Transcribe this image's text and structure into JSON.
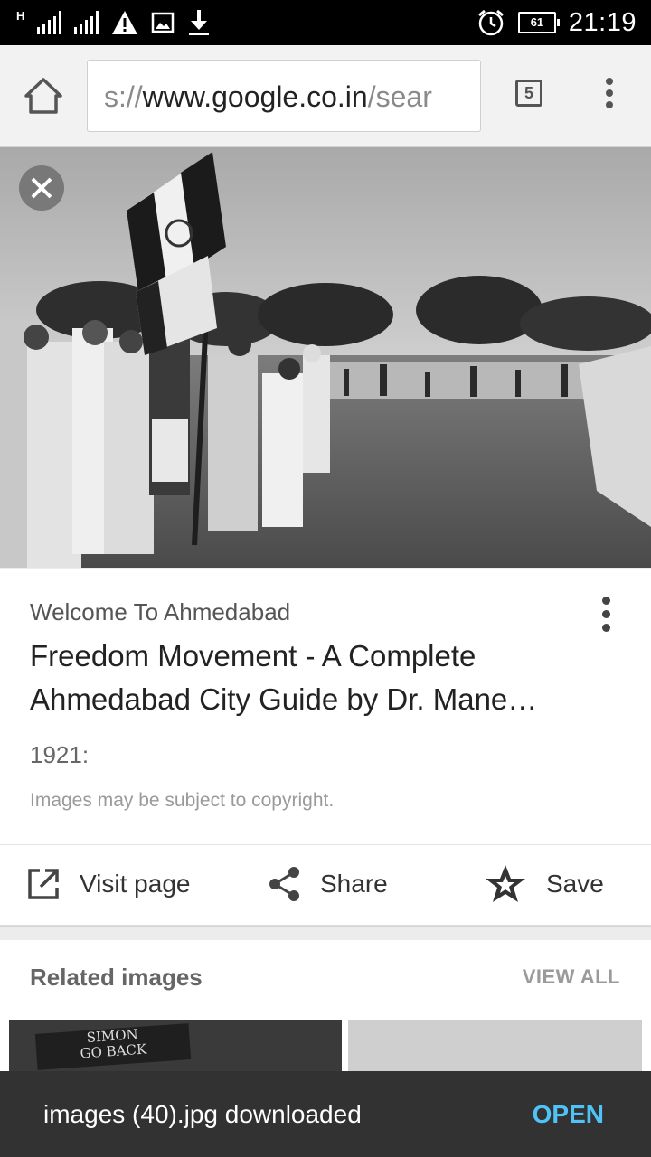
{
  "status_bar": {
    "network": "H",
    "battery": "61",
    "time": "21:19",
    "icons": [
      "signal-icon",
      "warning-icon",
      "image-icon",
      "download-icon",
      "alarm-icon",
      "battery-icon"
    ]
  },
  "toolbar": {
    "url_scheme": "s://",
    "url_host": "www.google.co.in",
    "url_rest": "/sear",
    "tab_count": "5"
  },
  "result": {
    "site": "Welcome To Ahmedabad",
    "title": "Freedom Movement - A Complete Ahmedabad City Guide by Dr. Mane…",
    "date": "1921:",
    "copyright": "Images may be subject to copyright.",
    "actions": {
      "visit": "Visit page",
      "share": "Share",
      "save": "Save"
    }
  },
  "related": {
    "title": "Related images",
    "view_all": "VIEW ALL",
    "thumb1_banner": "SIMON\nGO BACK"
  },
  "snackbar": {
    "message": "images (40).jpg downloaded",
    "action": "OPEN"
  },
  "colors": {
    "accent": "#4fc3f7",
    "snackbar_bg": "#323232",
    "status_bar_bg": "#000000"
  }
}
